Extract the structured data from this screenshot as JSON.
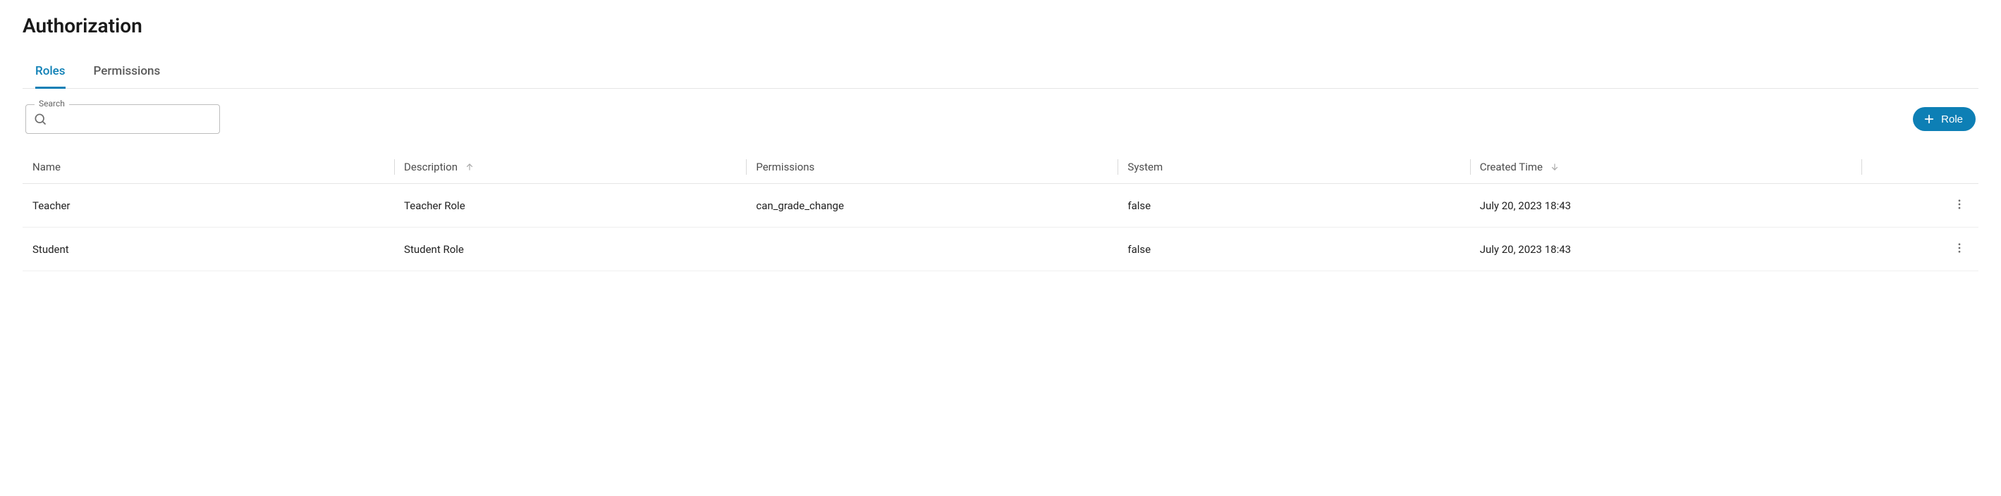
{
  "page": {
    "title": "Authorization"
  },
  "tabs": {
    "roles": "Roles",
    "permissions": "Permissions"
  },
  "search": {
    "label": "Search",
    "value": ""
  },
  "actions": {
    "add_role": "Role"
  },
  "columns": {
    "name": "Name",
    "description": "Description",
    "permissions": "Permissions",
    "system": "System",
    "created": "Created Time"
  },
  "rows": [
    {
      "name": "Teacher",
      "description": "Teacher Role",
      "permissions": "can_grade_change",
      "system": "false",
      "created": "July 20, 2023 18:43"
    },
    {
      "name": "Student",
      "description": "Student Role",
      "permissions": "",
      "system": "false",
      "created": "July 20, 2023 18:43"
    }
  ]
}
